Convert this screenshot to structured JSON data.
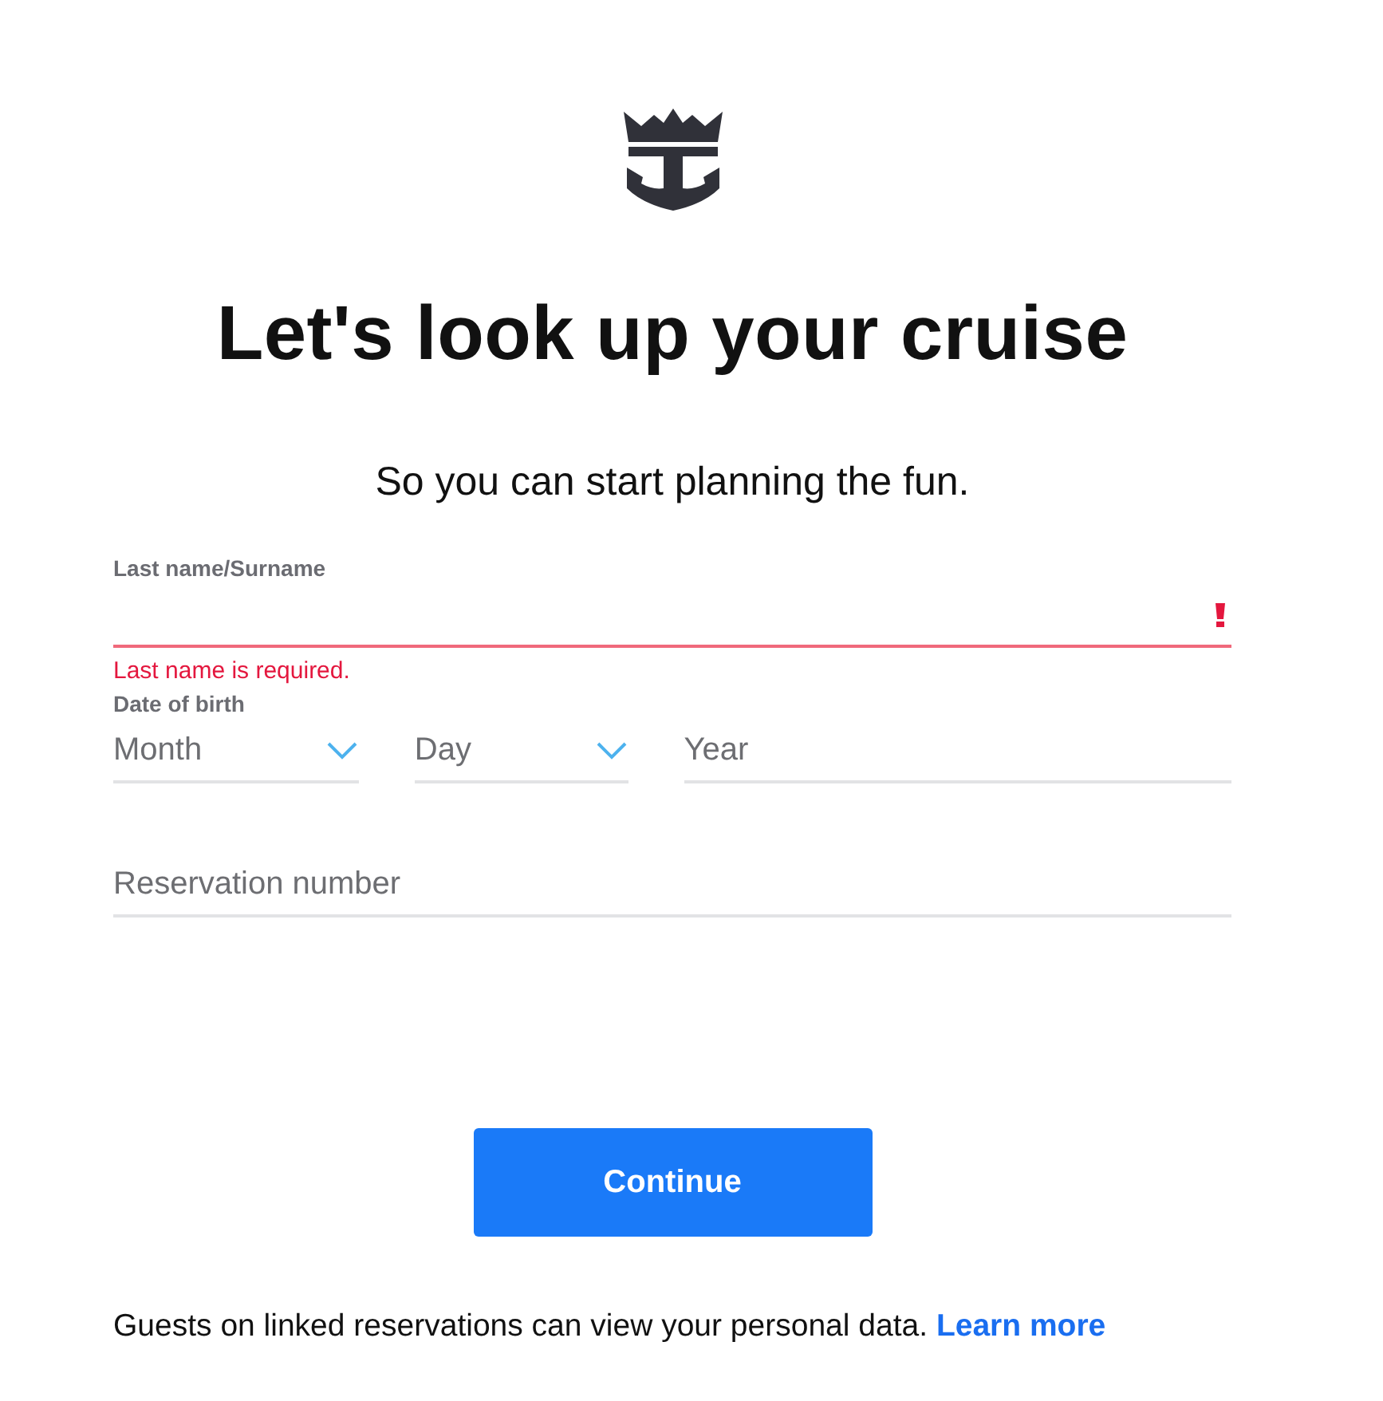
{
  "heading": "Let's look up your cruise",
  "subheading": "So you can start planning the fun.",
  "last_name": {
    "label": "Last name/Surname",
    "invalid": true,
    "error": "Last name is required."
  },
  "date_of_birth": {
    "label": "Date of birth",
    "fields": [
      {
        "kind": "select",
        "placeholder": "Month"
      },
      {
        "kind": "select",
        "placeholder": "Day"
      },
      {
        "kind": "text",
        "placeholder": "Year"
      }
    ]
  },
  "reservation_number": {
    "placeholder": "Reservation number"
  },
  "continue_button": "Continue",
  "footer": {
    "text": "Guests on linked reservations can view your personal data.",
    "link": "Learn more"
  }
}
